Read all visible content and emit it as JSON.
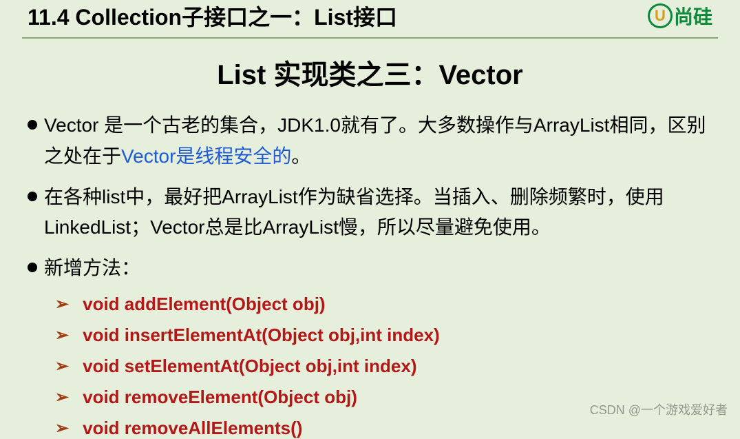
{
  "header": {
    "title": "11.4 Collection子接口之一：List接口",
    "logo_char": "U",
    "logo_text": "尚硅"
  },
  "slide_title": "List 实现类之三：Vector",
  "bullets": [
    {
      "pre": "Vector 是一个古老的集合，JDK1.0就有了。大多数操作与ArrayList相同，区别之处在于",
      "highlight": "Vector是线程安全的",
      "post": "。"
    },
    {
      "pre": "在各种list中，最好把ArrayList作为缺省选择。当插入、删除频繁时，使用LinkedList；Vector总是比ArrayList慢，所以尽量避免使用。",
      "highlight": "",
      "post": ""
    },
    {
      "pre": "新增方法：",
      "highlight": "",
      "post": ""
    }
  ],
  "methods": [
    "void addElement(Object obj)",
    "void insertElementAt(Object obj,int index)",
    "void setElementAt(Object obj,int index)",
    "void removeElement(Object obj)",
    "void removeAllElements()"
  ],
  "arrow": "➢",
  "watermark": "CSDN @一个游戏爱好者"
}
